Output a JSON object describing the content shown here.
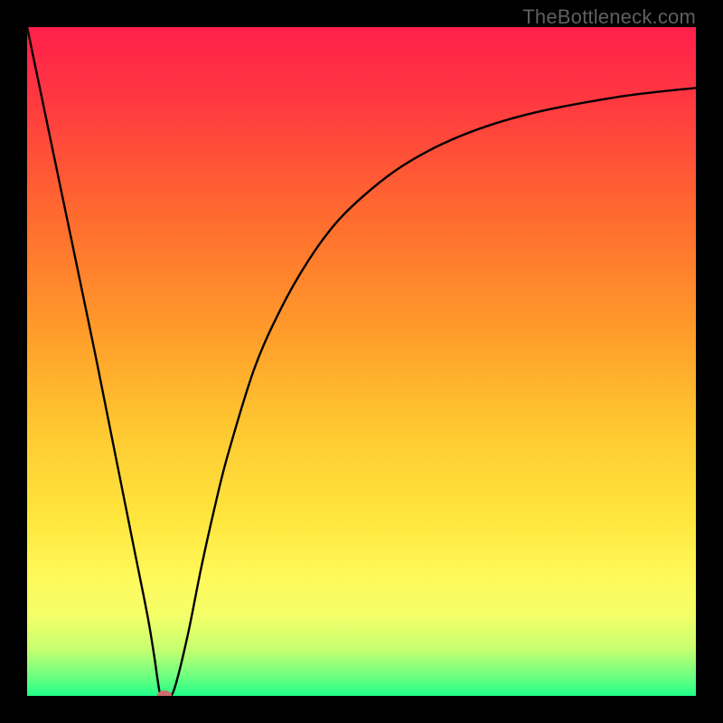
{
  "watermark": "TheBottleneck.com",
  "colors": {
    "frame": "#000000",
    "gradient_stops": [
      {
        "pct": 0,
        "color": "#ff1f4b"
      },
      {
        "pct": 12,
        "color": "#ff3b3f"
      },
      {
        "pct": 28,
        "color": "#ff6a2f"
      },
      {
        "pct": 45,
        "color": "#ff9a2a"
      },
      {
        "pct": 60,
        "color": "#ffc830"
      },
      {
        "pct": 74,
        "color": "#ffe73e"
      },
      {
        "pct": 82,
        "color": "#fff85a"
      },
      {
        "pct": 88,
        "color": "#f4ff68"
      },
      {
        "pct": 93,
        "color": "#c6ff70"
      },
      {
        "pct": 97,
        "color": "#6fff80"
      },
      {
        "pct": 100,
        "color": "#1fff88"
      }
    ],
    "curve": "#000000",
    "marker": "#cf6a6d"
  },
  "chart_data": {
    "type": "line",
    "title": "",
    "xlabel": "",
    "ylabel": "",
    "xlim": [
      0,
      100
    ],
    "ylim": [
      0,
      100
    ],
    "grid": false,
    "legend": false,
    "x": [
      0,
      5,
      10,
      14,
      16,
      18,
      19,
      19.5,
      20,
      21,
      22,
      24,
      26,
      28,
      30,
      34,
      38,
      42,
      46,
      50,
      55,
      60,
      65,
      70,
      75,
      80,
      85,
      90,
      95,
      100
    ],
    "values": [
      100,
      76,
      52,
      32,
      22,
      12,
      6,
      2.5,
      0,
      0,
      1,
      9,
      19,
      28,
      36,
      49,
      58,
      65,
      70.5,
      74.5,
      78.5,
      81.5,
      83.8,
      85.6,
      87,
      88.1,
      89,
      89.8,
      90.4,
      90.9
    ],
    "marker": {
      "x": 20.5,
      "y": 0
    },
    "notes": "Bottleneck-style V-curve; optimum at ~20% on x-axis where curve touches bottom (0). Values are percentages read off the normalized plot area (0 = bottom/green, 100 = top/red)."
  }
}
